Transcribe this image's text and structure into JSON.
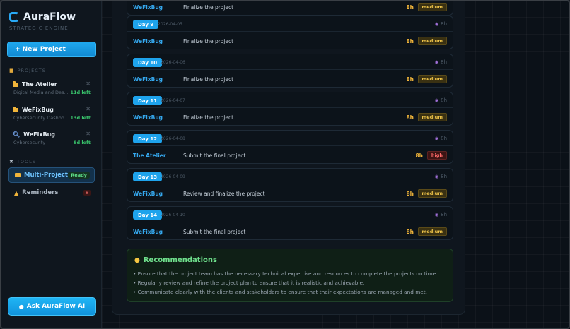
{
  "app": {
    "name": "AuraFlow",
    "subtitle": "STRATEGIC ENGINE"
  },
  "sidebar": {
    "new_project": "+ New Project",
    "projects_label": "PROJECTS",
    "projects": [
      {
        "name": "The Atelier",
        "desc": "Digital Media and Des...",
        "left": "11d left",
        "icon": "folder-icon"
      },
      {
        "name": "WeFixBug",
        "desc": "Cybersecurity Dashbo...",
        "left": "13d left",
        "icon": "folder-icon"
      },
      {
        "name": "WeFixBug",
        "desc": "Cybersecurity",
        "left": "8d left",
        "icon": "search-icon"
      }
    ],
    "tools_label": "TOOLS",
    "tools": [
      {
        "label": "Multi-Project",
        "badge": "Ready"
      },
      {
        "label": "Reminders",
        "badge": "8"
      }
    ],
    "ask": "Ask AuraFlow AI"
  },
  "days": [
    {
      "day": "",
      "date": "",
      "hours": "",
      "project": "WeFixBug",
      "task": "Finalize the project",
      "task_hours": "8h",
      "priority": "medium"
    },
    {
      "day": "Day 9",
      "date": "2026-04-05",
      "hours": "8h",
      "project": "WeFixBug",
      "task": "Finalize the project",
      "task_hours": "8h",
      "priority": "medium"
    },
    {
      "day": "Day 10",
      "date": "2026-04-06",
      "hours": "8h",
      "project": "WeFixBug",
      "task": "Finalize the project",
      "task_hours": "8h",
      "priority": "medium"
    },
    {
      "day": "Day 11",
      "date": "2026-04-07",
      "hours": "8h",
      "project": "WeFixBug",
      "task": "Finalize the project",
      "task_hours": "8h",
      "priority": "medium"
    },
    {
      "day": "Day 12",
      "date": "2026-04-08",
      "hours": "8h",
      "project": "The Atelier",
      "task": "Submit the final project",
      "task_hours": "8h",
      "priority": "high"
    },
    {
      "day": "Day 13",
      "date": "2026-04-09",
      "hours": "8h",
      "project": "WeFixBug",
      "task": "Review and finalize the project",
      "task_hours": "8h",
      "priority": "medium"
    },
    {
      "day": "Day 14",
      "date": "2026-04-10",
      "hours": "8h",
      "project": "WeFixBug",
      "task": "Submit the final project",
      "task_hours": "8h",
      "priority": "medium"
    }
  ],
  "recommendations": {
    "title": "Recommendations",
    "items": [
      "• Ensure that the project team has the necessary technical expertise and resources to complete the projects on time.",
      "• Regularly review and refine the project plan to ensure that it is realistic and achievable.",
      "• Communicate clearly with the clients and stakeholders to ensure that their expectations are managed and met."
    ]
  },
  "colors": {
    "accent": "#1ea3ec",
    "success": "#38c06a",
    "warning": "#f0b43a",
    "danger": "#ff6a6a"
  }
}
